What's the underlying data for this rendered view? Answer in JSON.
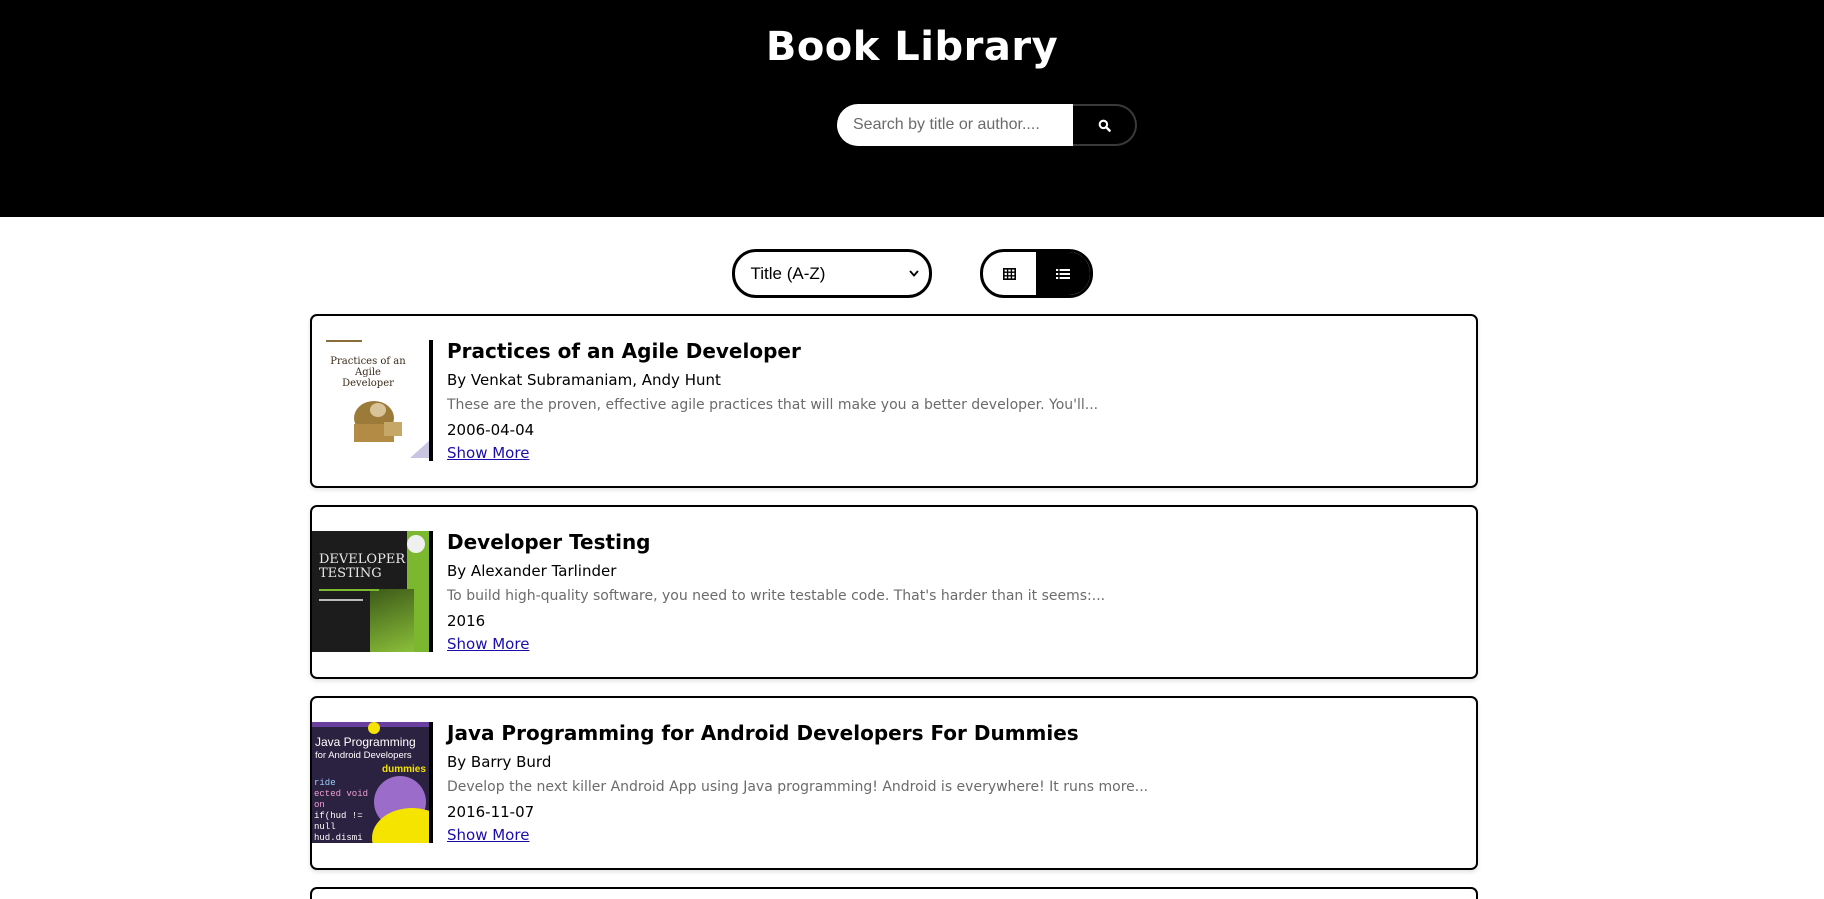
{
  "app": {
    "title": "Book Library"
  },
  "search": {
    "placeholder": "Search by title or author....",
    "value": "",
    "icon": "search-icon"
  },
  "controls": {
    "sort_selected": "Title (A-Z)",
    "view_modes": [
      {
        "icon": "grid-icon",
        "active": false
      },
      {
        "icon": "list-icon",
        "active": true
      }
    ]
  },
  "books": [
    {
      "title": "Practices of an Agile Developer",
      "authors": "By Venkat Subramaniam, Andy Hunt",
      "description": "These are the proven, effective agile practices that will make you a better developer. You'll...",
      "date": "2006-04-04",
      "show_more": "Show More",
      "cover_text": [
        "Practices of an",
        "Agile",
        "Developer"
      ]
    },
    {
      "title": "Developer Testing",
      "authors": "By Alexander Tarlinder",
      "description": "To build high-quality software, you need to write testable code. That's harder than it seems:...",
      "date": "2016",
      "show_more": "Show More",
      "cover_text": [
        "DEVELOPER",
        "TESTING"
      ]
    },
    {
      "title": "Java Programming for Android Developers For Dummies",
      "authors": "By Barry Burd",
      "description": "Develop the next killer Android App using Java programming! Android is everywhere! It runs more...",
      "date": "2016-11-07",
      "show_more": "Show More",
      "cover_text": [
        "Java Programming",
        "for Android Developers",
        "dummies"
      ]
    }
  ],
  "colors": {
    "header_bg": "#000000",
    "link": "#1a0dab",
    "description": "#6b6b6b"
  }
}
